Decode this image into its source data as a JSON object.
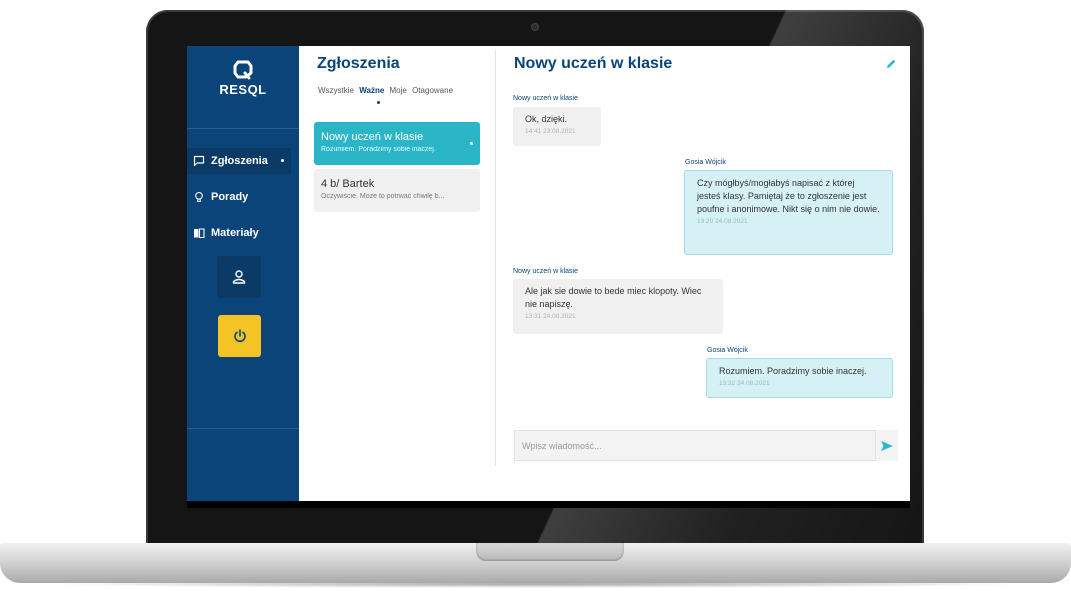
{
  "app": {
    "brand": "RESQL",
    "colors": {
      "sidebar": "#0a4478",
      "accent": "#2bb6c8",
      "power": "#f4c324",
      "outgoing": "#d6f1f6"
    }
  },
  "sidebar": {
    "items": [
      {
        "label": "Zgłoszenia",
        "icon": "chat-icon",
        "active": true
      },
      {
        "label": "Porady",
        "icon": "lightbulb-icon",
        "active": false
      },
      {
        "label": "Materiały",
        "icon": "book-icon",
        "active": false
      }
    ],
    "profile_icon": "user-icon",
    "power_icon": "power-icon"
  },
  "tickets": {
    "title": "Zgłoszenia",
    "filters": [
      {
        "label": "Wszystkie",
        "active": false
      },
      {
        "label": "Ważne",
        "active": true
      },
      {
        "label": "Moje",
        "active": false
      },
      {
        "label": "Otagowane",
        "active": false
      }
    ],
    "items": [
      {
        "title": "Nowy uczeń w klasie",
        "preview": "Rozumiem. Poradzimy sobie inaczej.",
        "active": true
      },
      {
        "title": "4 b/ Bartek",
        "preview": "Oczywiście. Może to potrwać chwilę b...",
        "active": false
      }
    ]
  },
  "chat": {
    "title": "Nowy uczeń w klasie",
    "edit_icon": "pencil-icon",
    "messages": [
      {
        "direction": "in",
        "sender": "Nowy uczeń w klasie",
        "text": "Ok, dzięki.",
        "time": "14:41 23.08.2021"
      },
      {
        "direction": "out",
        "sender": "Gosia Wójcik",
        "text": "Czy mógłbyś/mogłabyś napisać z której jesteś klasy. Pamiętaj że to zgłoszenie jest poufne i anonimowe. Nikt się o nim nie dowie.",
        "time": "13:20 24.08.2021"
      },
      {
        "direction": "in",
        "sender": "Nowy uczeń w klasie",
        "text": "Ale jak sie dowie to bede miec klopoty. Wiec nie napiszę.",
        "time": "13:31 24.08.2021"
      },
      {
        "direction": "out",
        "sender": "Gosia Wójcik",
        "text": "Rozumiem. Poradzimy sobie inaczej.",
        "time": "13:32 24.08.2021"
      }
    ],
    "input": {
      "placeholder": "Wpisz wiadomość...",
      "value": ""
    },
    "send_icon": "send-icon"
  }
}
